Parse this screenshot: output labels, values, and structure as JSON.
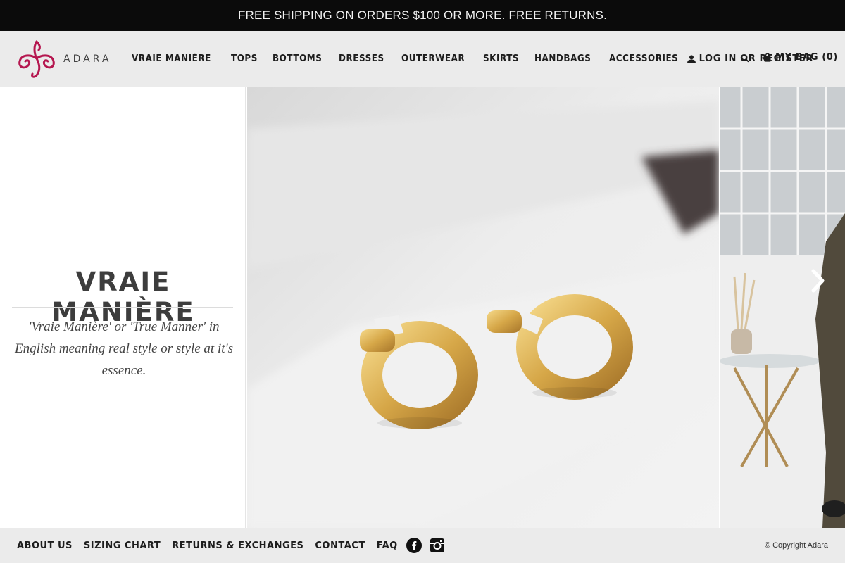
{
  "announcement": "FREE SHIPPING ON ORDERS $100 OR MORE. FREE RETURNS.",
  "brand": {
    "name": "ADARA",
    "accent_color": "#b5164f"
  },
  "nav": {
    "items": [
      "VRAIE MANIÈRE",
      "TOPS",
      "BOTTOMS",
      "DRESSES",
      "OUTERWEAR",
      "SKIRTS",
      "HANDBAGS",
      "ACCESSORIES"
    ],
    "login": "LOG IN OR REGISTER",
    "bag": "MY BAG (0)",
    "icons": {
      "login": "user-icon",
      "search": "search-icon",
      "bag": "bag-icon"
    }
  },
  "slide": {
    "title": "VRAIE MANIÈRE",
    "description": "'Vraie Manière' or 'True Manner' in English meaning real style or style at it's essence.",
    "next_icon": "chevron-right-icon"
  },
  "footer": {
    "links": [
      "ABOUT US",
      "SIZING CHART",
      "RETURNS & EXCHANGES",
      "CONTACT",
      "FAQ"
    ],
    "social_icons": [
      "facebook-icon",
      "instagram-icon"
    ],
    "copyright": "© Copyright Adara"
  }
}
